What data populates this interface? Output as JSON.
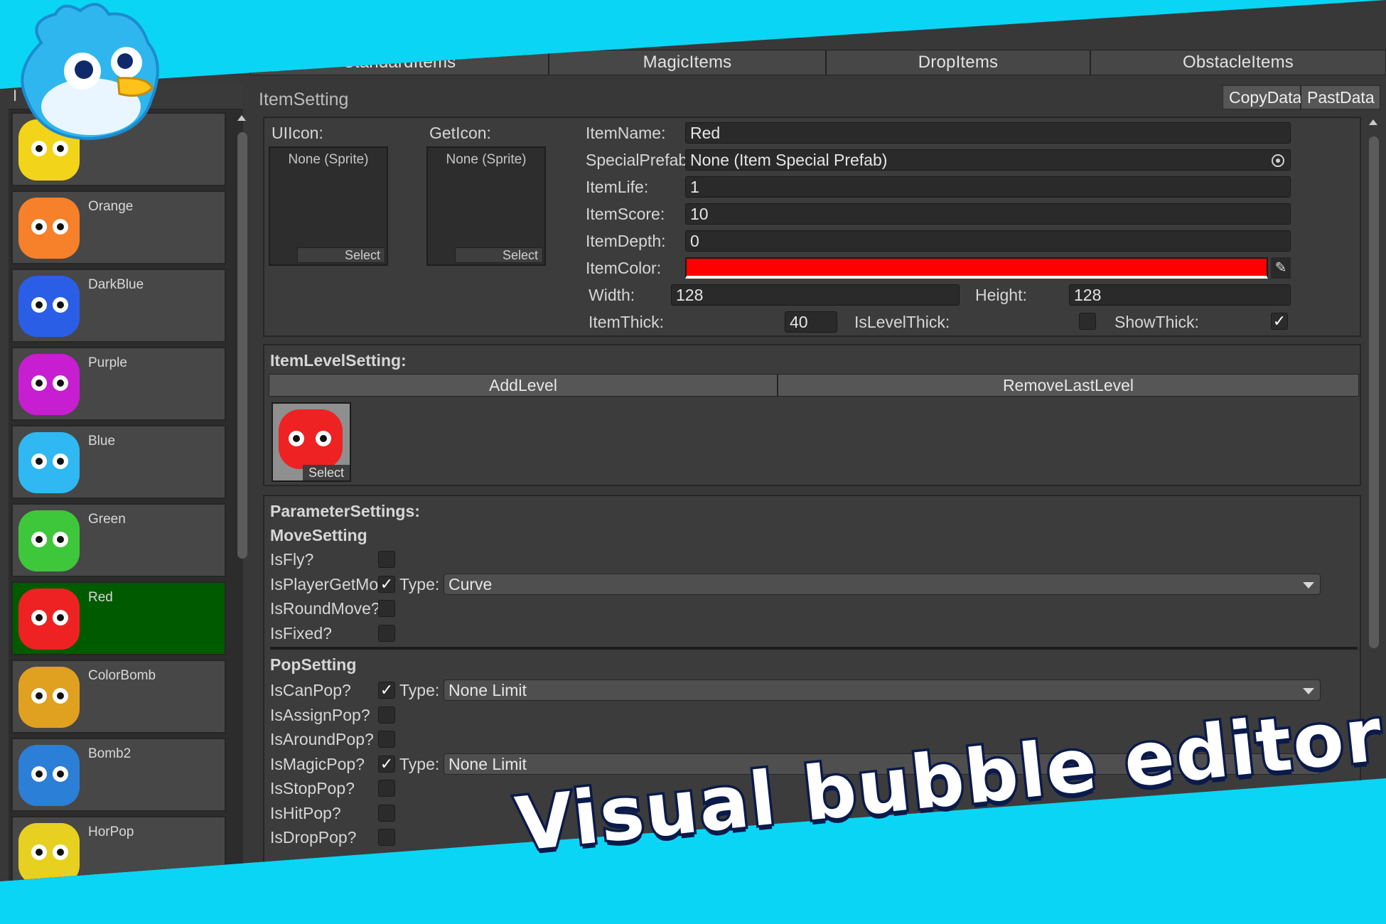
{
  "tabs": [
    "StandardItems",
    "MagicItems",
    "DropItems",
    "ObstacleItems"
  ],
  "left_header_label": "I",
  "items": [
    {
      "name": "",
      "color": "#f2d51a"
    },
    {
      "name": "Orange",
      "color": "#f7802a"
    },
    {
      "name": "DarkBlue",
      "color": "#2b5ee6"
    },
    {
      "name": "Purple",
      "color": "#c81ed1"
    },
    {
      "name": "Blue",
      "color": "#2fb8f2"
    },
    {
      "name": "Green",
      "color": "#3fc73b"
    },
    {
      "name": "Red",
      "color": "#ee2222",
      "selected": true
    },
    {
      "name": "ColorBomb",
      "color": "#e0a020"
    },
    {
      "name": "Bomb2",
      "color": "#2b7fd6"
    },
    {
      "name": "HorPop",
      "color": "#e8d020"
    }
  ],
  "setting": {
    "title": "ItemSetting",
    "copy_label": "CopyData",
    "past_label": "PastData"
  },
  "icons": {
    "ui_label": "UIIcon:",
    "get_label": "GetIcon:",
    "none_text": "None (Sprite)",
    "select": "Select"
  },
  "fields": {
    "item_name_label": "ItemName:",
    "item_name": "Red",
    "special_prefab_label": "SpecialPrefab:",
    "special_prefab": "None (Item Special Prefab)",
    "item_life_label": "ItemLife:",
    "item_life": "1",
    "item_score_label": "ItemScore:",
    "item_score": "10",
    "item_depth_label": "ItemDepth:",
    "item_depth": "0",
    "item_color_label": "ItemColor:",
    "item_color": "#ff0000",
    "width_label": "Width:",
    "width": "128",
    "height_label": "Height:",
    "height": "128",
    "item_thick_label": "ItemThick:",
    "item_thick": "40",
    "is_level_thick_label": "IsLevelThick:",
    "is_level_thick": false,
    "show_thick_label": "ShowThick:",
    "show_thick": true
  },
  "level": {
    "title": "ItemLevelSetting:",
    "add": "AddLevel",
    "remove": "RemoveLastLevel",
    "select": "Select"
  },
  "params": {
    "title": "ParameterSettings:",
    "move_title": "MoveSetting",
    "move": [
      {
        "label": "IsFly?",
        "checked": false
      },
      {
        "label": "IsPlayerGetMove",
        "checked": true,
        "type": "Curve"
      },
      {
        "label": "IsRoundMove?",
        "checked": false
      },
      {
        "label": "IsFixed?",
        "checked": false
      }
    ],
    "pop_title": "PopSetting",
    "pop": [
      {
        "label": "IsCanPop?",
        "checked": true,
        "type": "None Limit"
      },
      {
        "label": "IsAssignPop?",
        "checked": false
      },
      {
        "label": "IsAroundPop?",
        "checked": false
      },
      {
        "label": "IsMagicPop?",
        "checked": true,
        "type": "None Limit"
      },
      {
        "label": "IsStopPop?",
        "checked": false
      },
      {
        "label": "IsHitPop?",
        "checked": false
      },
      {
        "label": "IsDropPop?",
        "checked": false
      }
    ],
    "type_label": "Type:"
  },
  "banner": "Visual bubble editor"
}
